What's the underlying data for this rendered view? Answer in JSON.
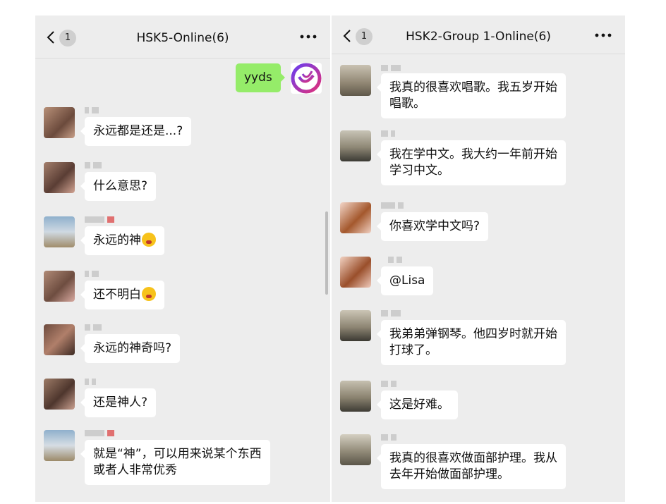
{
  "left": {
    "back_badge": "1",
    "title": "HSK5-Online(6)",
    "outgoing": {
      "text": "yyds"
    },
    "messages": [
      {
        "text": "永远都是还是...?",
        "avatar": "avatar-photo"
      },
      {
        "text": "什么意思?",
        "avatar": "avatar-photo"
      },
      {
        "text": "永远的神",
        "emoji": "surprised-face-emoji",
        "avatar": "avatar-photo"
      },
      {
        "text": "还不明白",
        "emoji": "laughing-crying-emoji",
        "avatar": "avatar-photo"
      },
      {
        "text": "永远的神奇吗?",
        "avatar": "avatar-photo"
      },
      {
        "text": "还是神人?",
        "avatar": "avatar-photo"
      },
      {
        "text": "就是“神”，可以用来说某个东西\n或者人非常优秀",
        "avatar": "avatar-photo"
      }
    ]
  },
  "right": {
    "back_badge": "1",
    "title": "HSK2-Group 1-Online(6)",
    "messages": [
      {
        "text": "我真的很喜欢唱歌。我五岁开始\n唱歌。",
        "avatar": "avatar-photo"
      },
      {
        "text": "我在学中文。我大约一年前开始\n学习中文。",
        "avatar": "avatar-photo"
      },
      {
        "text": "你喜欢学中文吗?",
        "avatar": "avatar-photo"
      },
      {
        "text": "@Lisa",
        "avatar": "avatar-photo"
      },
      {
        "text": "我弟弟弹钢琴。他四岁时就开始\n打球了。",
        "avatar": "avatar-photo"
      },
      {
        "text": "这是好难。",
        "avatar": "avatar-photo"
      },
      {
        "text": "我真的很喜欢做面部护理。我从\n去年开始做面部护理。",
        "avatar": "avatar-photo"
      }
    ]
  },
  "colors": {
    "chat_bg": "#ededed",
    "bubble_in": "#ffffff",
    "bubble_out": "#95ec69",
    "badge": "#cfcfcf"
  },
  "icons": [
    "back-chevron-icon",
    "more-options-icon",
    "surprised-face-emoji",
    "laughing-crying-emoji",
    "gradient-logo-avatar"
  ]
}
